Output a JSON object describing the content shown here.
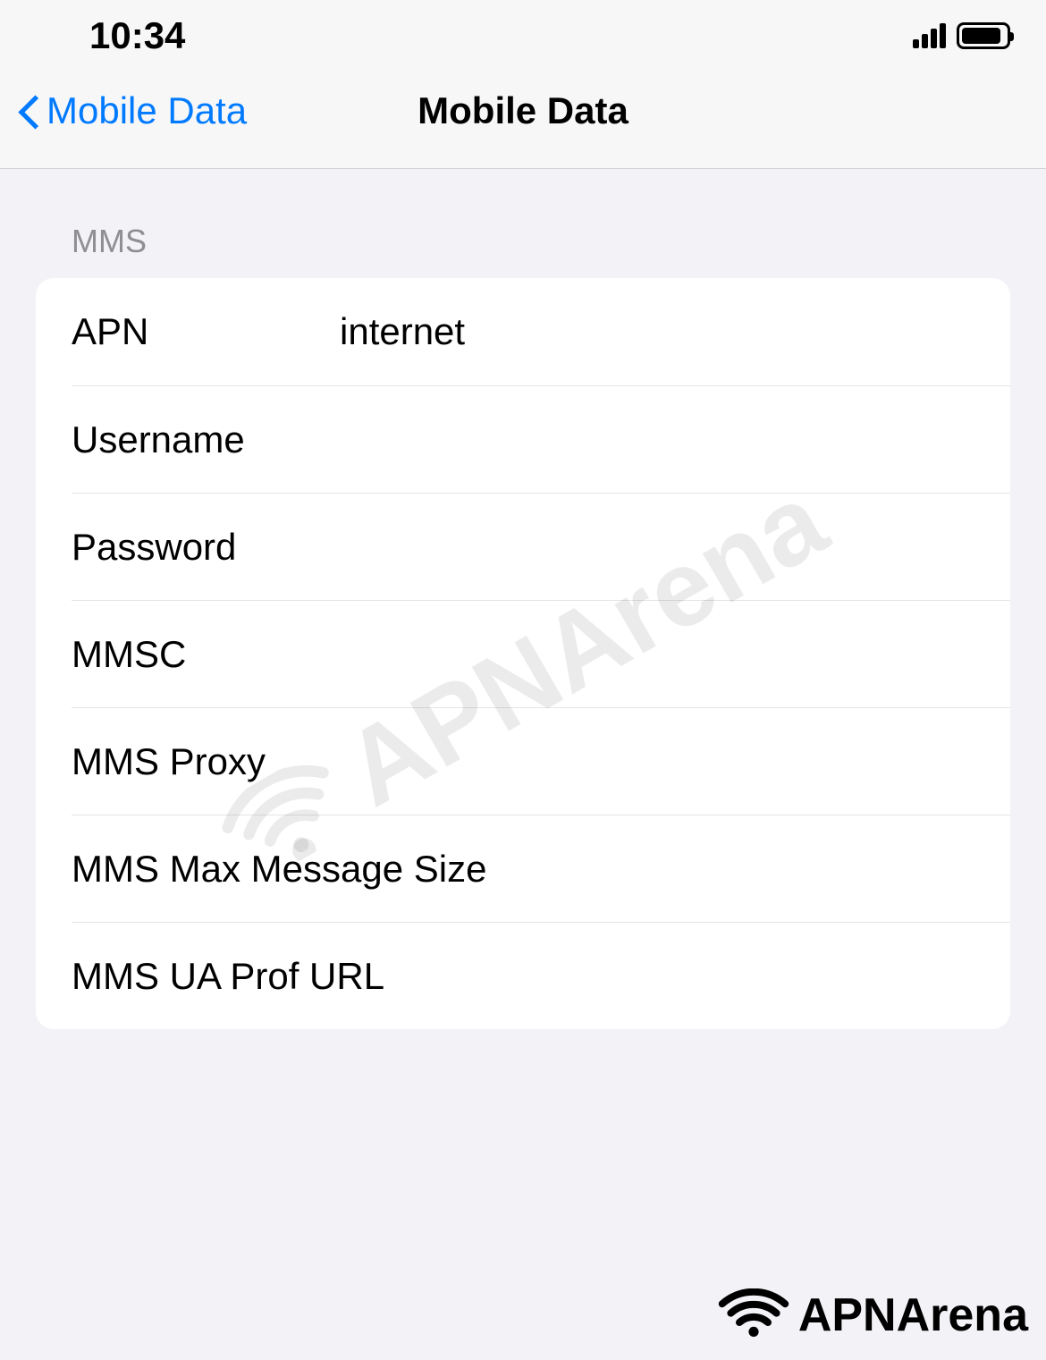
{
  "status_bar": {
    "time": "10:34"
  },
  "nav": {
    "back_label": "Mobile Data",
    "title": "Mobile Data"
  },
  "section": {
    "header": "MMS"
  },
  "fields": {
    "apn": {
      "label": "APN",
      "value": "internet"
    },
    "username": {
      "label": "Username",
      "value": ""
    },
    "password": {
      "label": "Password",
      "value": ""
    },
    "mmsc": {
      "label": "MMSC",
      "value": ""
    },
    "mms_proxy": {
      "label": "MMS Proxy",
      "value": ""
    },
    "mms_max_size": {
      "label": "MMS Max Message Size",
      "value": ""
    },
    "mms_ua_prof": {
      "label": "MMS UA Prof URL",
      "value": ""
    }
  },
  "watermark": {
    "text": "APNArena"
  },
  "footer": {
    "logo_text": "APNArena"
  }
}
